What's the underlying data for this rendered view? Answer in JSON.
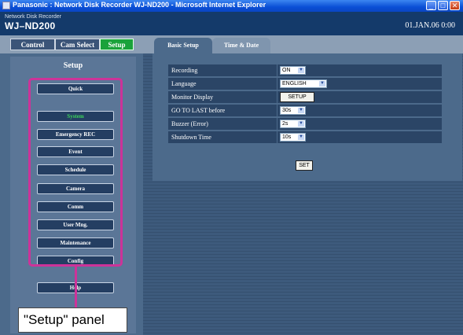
{
  "window": {
    "title": "Panasonic : Network Disk Recorder WJ-ND200 - Microsoft Internet Explorer",
    "controls": [
      "_",
      "□",
      "✕"
    ]
  },
  "header": {
    "product_line": "Network Disk Recorder",
    "model": "WJ–ND200",
    "clock": "01.JAN.06  0:00"
  },
  "main_tabs": [
    {
      "label": "Control"
    },
    {
      "label": "Cam Select"
    },
    {
      "label": "Setup",
      "active": true
    }
  ],
  "setup_panel": {
    "heading": "Setup",
    "items": [
      {
        "label": "Quick"
      },
      {
        "label": "System",
        "active": true
      },
      {
        "label": "Emergency REC"
      },
      {
        "label": "Event"
      },
      {
        "label": "Schedule"
      },
      {
        "label": "Camera"
      },
      {
        "label": "Comm"
      },
      {
        "label": "User Mng."
      },
      {
        "label": "Maintenance"
      },
      {
        "label": "Config"
      },
      {
        "label": "Help"
      }
    ],
    "highlight_color": "#cc3399"
  },
  "callout": {
    "text": "\"Setup\" panel"
  },
  "sub_tabs": [
    {
      "label": "Basic Setup",
      "active": true
    },
    {
      "label": "Time & Date"
    }
  ],
  "settings": {
    "rows": [
      {
        "label": "Recording",
        "type": "select",
        "value": "ON"
      },
      {
        "label": "Language",
        "type": "select",
        "value": "ENGLISH"
      },
      {
        "label": "Monitor Display",
        "type": "button",
        "value": "SETUP"
      },
      {
        "label": "GO TO LAST before",
        "type": "select",
        "value": "30s"
      },
      {
        "label": "Buzzer (Error)",
        "type": "select",
        "value": "2s"
      },
      {
        "label": "Shutdown Time",
        "type": "select",
        "value": "10s"
      }
    ],
    "set_button": "SET"
  },
  "colors": {
    "active_nav": "#3cd45a",
    "active_tab": "#1aa23a",
    "panel": "#4c6a8b"
  }
}
